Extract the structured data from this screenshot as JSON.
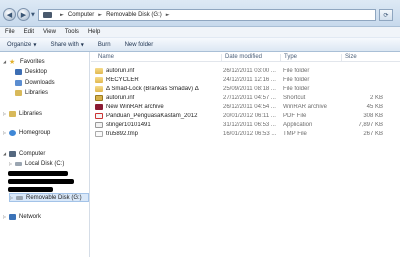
{
  "address": {
    "crumbs": [
      "Computer",
      "Removable Disk (G:)"
    ]
  },
  "menu": [
    "File",
    "Edit",
    "View",
    "Tools",
    "Help"
  ],
  "toolbar": {
    "organize": "Organize",
    "share": "Share with",
    "burn": "Burn",
    "new_folder": "New folder"
  },
  "nav": {
    "favorites": "Favorites",
    "desktop": "Desktop",
    "downloads": "Downloads",
    "libraries_fav": "Libraries",
    "libraries": "Libraries",
    "homegroup": "Homegroup",
    "computer": "Computer",
    "local_disk": "Local Disk (C:)",
    "removable": "Removable Disk (G:)",
    "network": "Network"
  },
  "columns": {
    "name": "Name",
    "date": "Date modified",
    "type": "Type",
    "size": "Size"
  },
  "files": [
    {
      "name": "autorun.inf",
      "date": "26/12/2011 03:00 ...",
      "type": "File folder",
      "size": "",
      "icon": "folder"
    },
    {
      "name": "RECYCLER",
      "date": "24/12/2011 12:16 ...",
      "type": "File folder",
      "size": "",
      "icon": "folder"
    },
    {
      "name": "Δ Smad-Lock (Brankas Smadav) Δ",
      "date": "25/09/2011 08:18 ...",
      "type": "File folder",
      "size": "",
      "icon": "folder"
    },
    {
      "name": "autorun.inf",
      "date": "27/12/2011 04:57 ...",
      "type": "Shortcut",
      "size": "2 KB",
      "icon": "shortcut"
    },
    {
      "name": "New WinRAR archive",
      "date": "26/12/2011 04:54 ...",
      "type": "WinRAR archive",
      "size": "45 KB",
      "icon": "rar"
    },
    {
      "name": "Panduan_PenguasaKastam_2012",
      "date": "20/01/2012 06:11 ...",
      "type": "PDF File",
      "size": "308 KB",
      "icon": "pdf"
    },
    {
      "name": "stinger10101491",
      "date": "31/12/2011 06:53 ...",
      "type": "Application",
      "size": "7,897 KB",
      "icon": "app"
    },
    {
      "name": "tru5892.tmp",
      "date": "16/01/2012 06:53 ...",
      "type": "TMP File",
      "size": "267 KB",
      "icon": "tmp"
    }
  ]
}
